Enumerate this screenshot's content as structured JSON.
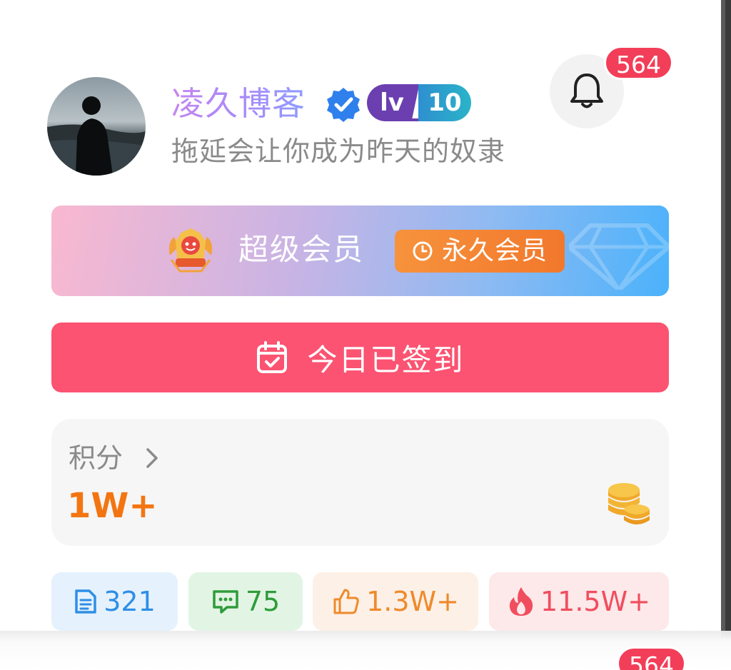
{
  "profile": {
    "name": "凌久博客",
    "motto": "拖延会让你成为昨天的奴隶",
    "level_prefix": "lv",
    "level_number": "10",
    "verified_icon": "verified-check-icon"
  },
  "notifications": {
    "count": "564",
    "icon": "bell-icon"
  },
  "vip": {
    "title": "超级会员",
    "tag": "永久会员",
    "tag_icon": "clock-icon",
    "crown_icon": "crown-icon"
  },
  "signin": {
    "label": "今日已签到",
    "icon": "calendar-check-icon",
    "color": "#fb5371"
  },
  "points": {
    "title": "积分",
    "value": "1W+",
    "icon": "coins-icon"
  },
  "stats": [
    {
      "icon": "document-icon",
      "value": "321",
      "color": "#2e8ee6"
    },
    {
      "icon": "comment-icon",
      "value": "75",
      "color": "#2f9c3a"
    },
    {
      "icon": "thumbs-up-icon",
      "value": "1.3W+",
      "color": "#ee8a2a"
    },
    {
      "icon": "fire-icon",
      "value": "11.5W+",
      "color": "#f04e5e"
    }
  ],
  "bottom_badge": {
    "count": "564"
  }
}
